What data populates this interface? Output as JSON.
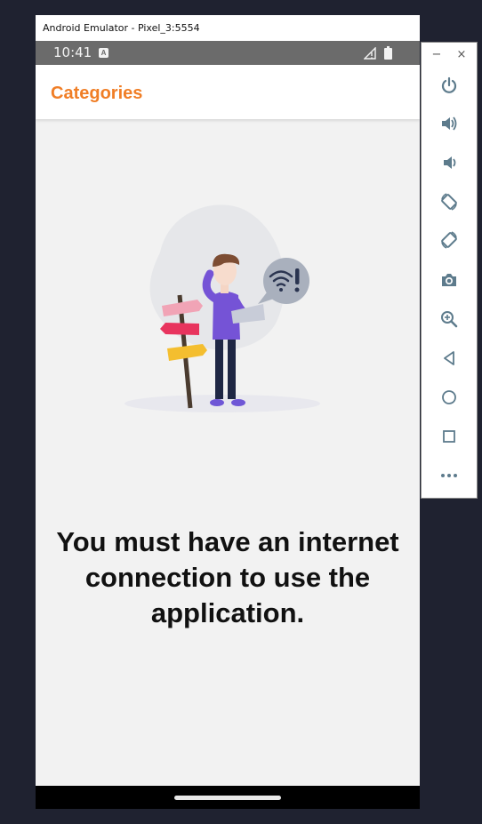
{
  "window": {
    "title": "Android Emulator - Pixel_3:5554"
  },
  "statusbar": {
    "time": "10:41",
    "notification_icon": "a-box-icon",
    "signal_icon": "signal-no-data-icon",
    "battery_icon": "battery-icon"
  },
  "appbar": {
    "title": "Categories",
    "accent_color": "#f07e26"
  },
  "content": {
    "illustration": "no-internet-illustration",
    "message": "You must have an internet connection to use the application."
  },
  "toolbar": {
    "minimize_label": "−",
    "close_label": "×",
    "buttons": [
      {
        "name": "power",
        "icon": "power-icon"
      },
      {
        "name": "volume-up",
        "icon": "volume-up-icon"
      },
      {
        "name": "volume-down",
        "icon": "volume-down-icon"
      },
      {
        "name": "rotate-left",
        "icon": "rotate-left-icon"
      },
      {
        "name": "rotate-right",
        "icon": "rotate-right-icon"
      },
      {
        "name": "screenshot",
        "icon": "camera-icon"
      },
      {
        "name": "zoom",
        "icon": "zoom-icon"
      },
      {
        "name": "back",
        "icon": "back-triangle-icon"
      },
      {
        "name": "home",
        "icon": "home-circle-icon"
      },
      {
        "name": "overview",
        "icon": "overview-square-icon"
      },
      {
        "name": "more",
        "icon": "more-dots-icon"
      }
    ]
  },
  "colors": {
    "icon": "#5d7b8c",
    "page_bg": "#f2f2f2",
    "desktop_bg": "#1f2230"
  }
}
